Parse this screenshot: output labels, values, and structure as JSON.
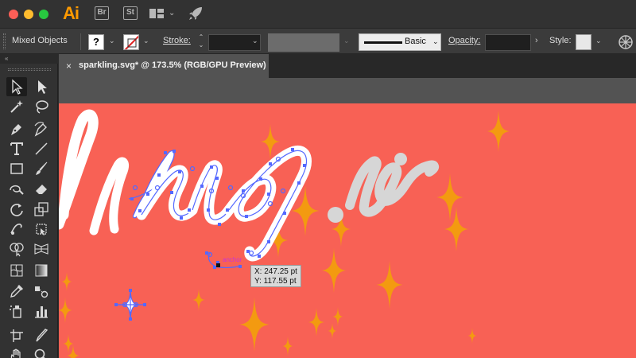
{
  "app": {
    "name": "Ai",
    "bridge": "Br",
    "stock": "St"
  },
  "titlebar_icons": {
    "workspace": "workspace-layout-icon",
    "gpu": "rocket-icon"
  },
  "control": {
    "selection_label": "Mixed Objects",
    "fill_value": "?",
    "stroke_label": "Stroke:",
    "stroke_weight": "",
    "brush_label": "Basic",
    "opacity_label": "Opacity:",
    "opacity_value": "",
    "style_label": "Style:"
  },
  "tab": {
    "close": "×",
    "title": "sparkling.svg* @ 173.5% (RGB/GPU Preview)"
  },
  "canvas": {
    "artboard_color": "#f86155",
    "sparkle_color": "#f39a10",
    "script_text_visible": "ling",
    "suffix_text_visible": ".io",
    "anchor_hint": "anchor"
  },
  "tooltip": {
    "x": "X: 247.25 pt",
    "y": "Y: 117.55 pt"
  },
  "tools": [
    "selection-tool-icon",
    "direct-selection-tool-icon",
    "magic-wand-tool-icon",
    "lasso-tool-icon",
    "pen-tool-icon",
    "curvature-tool-icon",
    "type-tool-icon",
    "line-tool-icon",
    "rectangle-tool-icon",
    "paintbrush-tool-icon",
    "shaper-tool-icon",
    "eraser-tool-icon",
    "rotate-tool-icon",
    "scale-tool-icon",
    "warp-tool-icon",
    "free-transform-tool-icon",
    "shape-builder-tool-icon",
    "perspective-grid-tool-icon",
    "mesh-tool-icon",
    "gradient-tool-icon",
    "eyedropper-tool-icon",
    "blend-tool-icon",
    "symbol-sprayer-tool-icon",
    "column-graph-tool-icon",
    "artboard-tool-icon",
    "slice-tool-icon",
    "hand-tool-icon",
    "zoom-tool-icon"
  ]
}
